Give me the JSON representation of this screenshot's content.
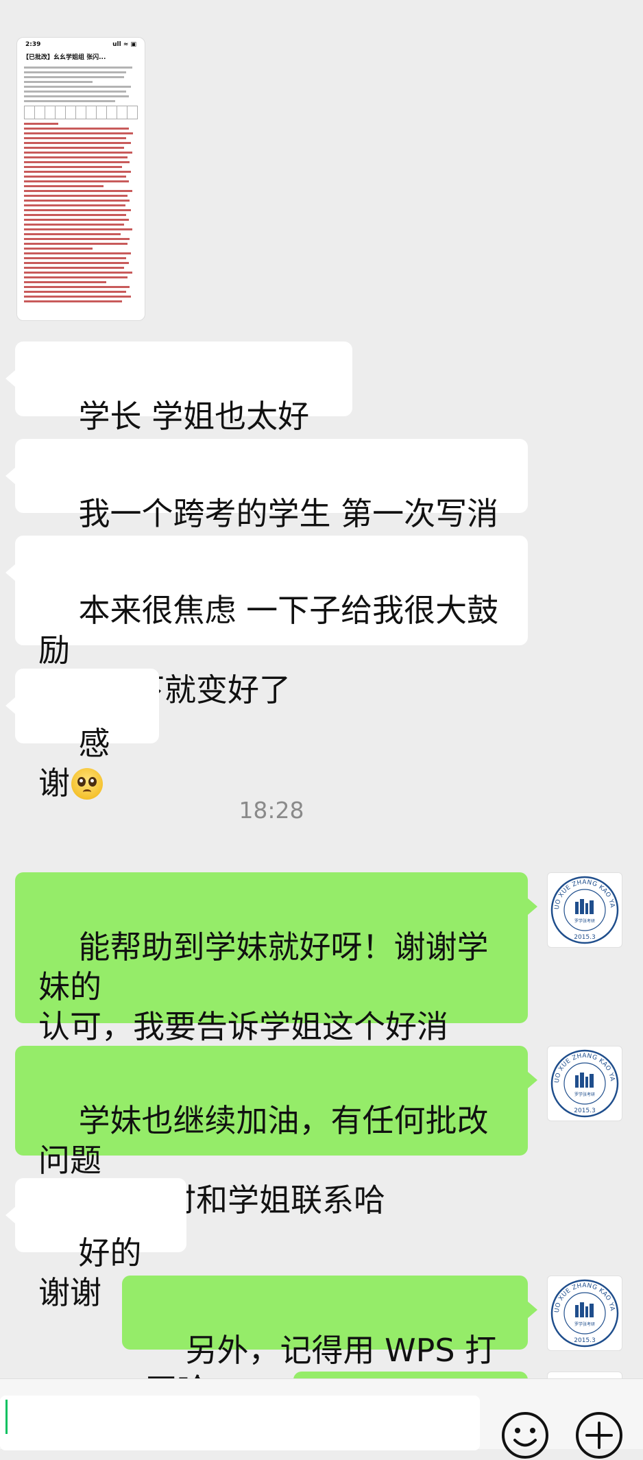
{
  "thumbnail": {
    "status_time": "2:39",
    "status_icons": "ull ≈ ▣",
    "title": "【已批改】幺幺学姐组 张闪..."
  },
  "messages": [
    {
      "side": "left",
      "text": "学长 学姐也太好了吧"
    },
    {
      "side": "left",
      "text": "我一个跨考的学生 第一次写消息"
    },
    {
      "side": "left",
      "text": "本来很焦虑 一下子给我很大鼓励\n心情一下就变好了"
    },
    {
      "side": "left",
      "text": "感谢",
      "emoji": "pleading-face-icon"
    }
  ],
  "timestamp": "18:28",
  "replies": [
    {
      "side": "right",
      "text": "能帮助到学妹就好呀！谢谢学妹的\n认可，我要告诉学姐这个好消息，\n哈哈哈"
    },
    {
      "side": "right",
      "text": "学妹也继续加油，有任何批改问题\n都可以随时和学姐联系哈"
    },
    {
      "side": "left",
      "text": "好的谢谢"
    },
    {
      "side": "right",
      "text": "另外，记得用 WPS 打开哈"
    }
  ],
  "avatar": {
    "arc_text": "LUO XUE ZHANG KAO YAN",
    "year": "2015.3",
    "inner_text": "罗学张考研"
  },
  "colors": {
    "background": "#ededed",
    "incoming_bubble": "#ffffff",
    "outgoing_bubble": "#95ec69",
    "avatar_ring": "#1f4e8c",
    "cursor": "#07c160"
  },
  "input": {
    "value": ""
  }
}
